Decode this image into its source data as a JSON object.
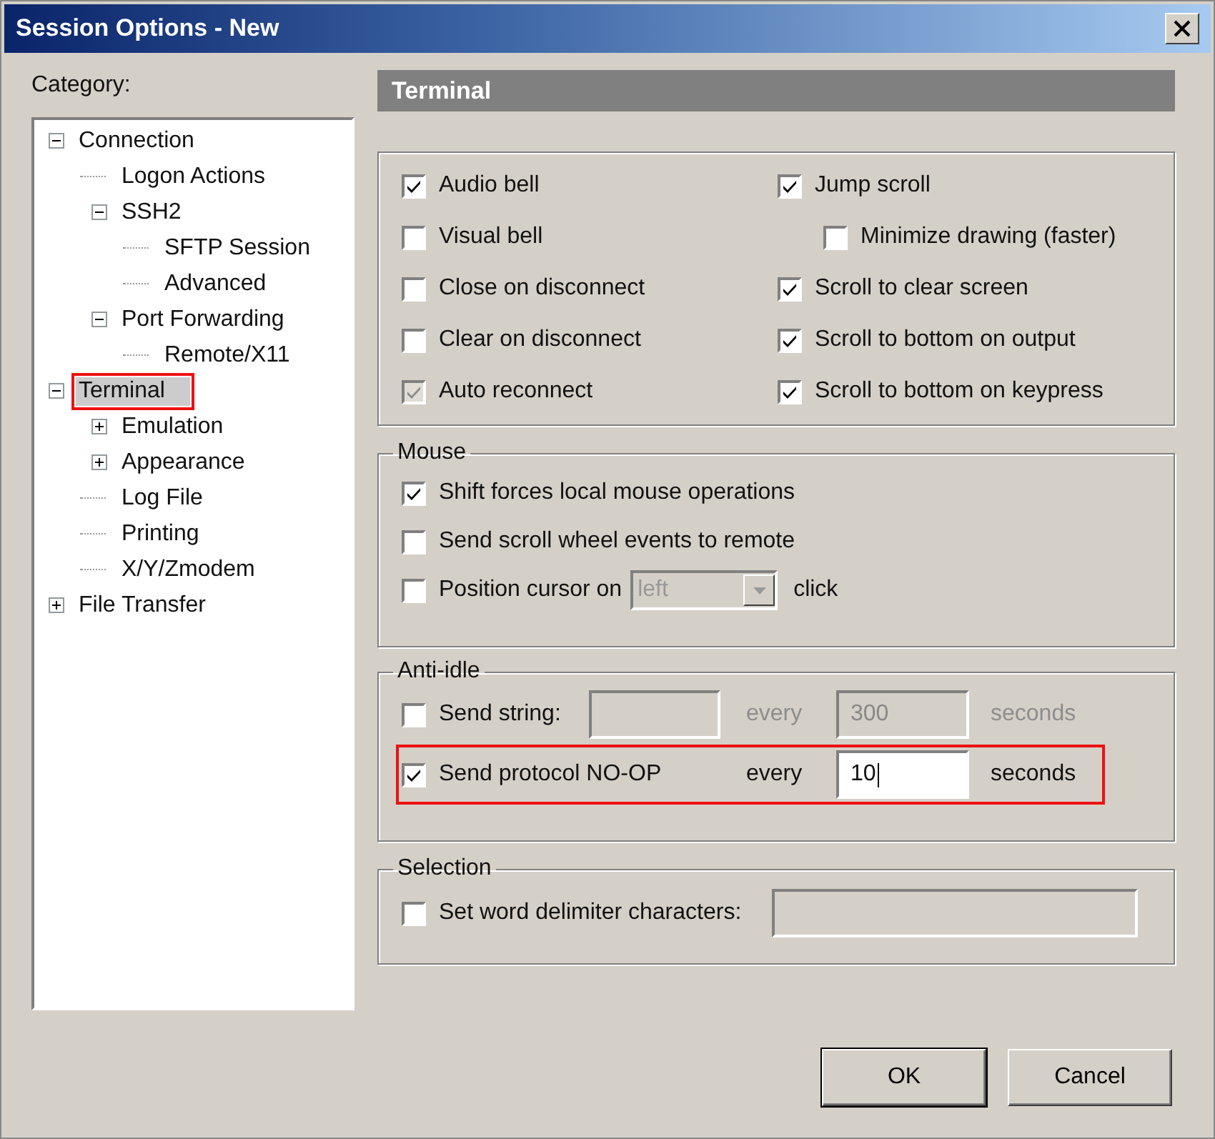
{
  "window": {
    "title": "Session Options - New"
  },
  "category_label": "Category:",
  "tree": [
    {
      "label": "Connection",
      "expanded": true,
      "selected": false,
      "annotated": false,
      "children": [
        {
          "label": "Logon Actions",
          "selected": false,
          "annotated": false
        },
        {
          "label": "SSH2",
          "expanded": true,
          "selected": false,
          "annotated": false,
          "children": [
            {
              "label": "SFTP Session",
              "selected": false,
              "annotated": false
            },
            {
              "label": "Advanced",
              "selected": false,
              "annotated": false
            }
          ]
        },
        {
          "label": "Port Forwarding",
          "expanded": true,
          "selected": false,
          "annotated": false,
          "children": [
            {
              "label": "Remote/X11",
              "selected": false,
              "annotated": false
            }
          ]
        }
      ]
    },
    {
      "label": "Terminal",
      "expanded": true,
      "selected": true,
      "annotated": true,
      "children": [
        {
          "label": "Emulation",
          "expanded": false,
          "selected": false,
          "annotated": false
        },
        {
          "label": "Appearance",
          "expanded": false,
          "selected": false,
          "annotated": false
        },
        {
          "label": "Log File",
          "selected": false,
          "annotated": false
        },
        {
          "label": "Printing",
          "selected": false,
          "annotated": false
        },
        {
          "label": "X/Y/Zmodem",
          "selected": false,
          "annotated": false
        }
      ]
    },
    {
      "label": "File Transfer",
      "expanded": false,
      "selected": false,
      "annotated": false
    }
  ],
  "panel_title": "Terminal",
  "options": [
    {
      "label": "Audio bell",
      "checked": true,
      "disabled": false,
      "kind": "main"
    },
    {
      "label": "Jump scroll",
      "checked": true,
      "disabled": false,
      "kind": "main"
    },
    {
      "label": "Visual bell",
      "checked": false,
      "disabled": false,
      "kind": "main"
    },
    {
      "label": "Minimize drawing (faster)",
      "checked": false,
      "disabled": false,
      "kind": "sub"
    },
    {
      "label": "Close on disconnect",
      "checked": false,
      "disabled": false,
      "kind": "main"
    },
    {
      "label": "Scroll to clear screen",
      "checked": true,
      "disabled": false,
      "kind": "main"
    },
    {
      "label": "Clear on disconnect",
      "checked": false,
      "disabled": false,
      "kind": "main"
    },
    {
      "label": "Scroll to bottom on output",
      "checked": true,
      "disabled": false,
      "kind": "main"
    },
    {
      "label": "Auto reconnect",
      "checked": true,
      "disabled": true,
      "kind": "main"
    },
    {
      "label": "Scroll to bottom on keypress",
      "checked": true,
      "disabled": false,
      "kind": "main"
    }
  ],
  "mouse": {
    "title": "Mouse",
    "options": [
      {
        "label": "Shift forces local mouse operations",
        "checked": true,
        "kind": "plain"
      },
      {
        "label": "Send scroll wheel events to remote",
        "checked": false,
        "kind": "plain"
      },
      {
        "label": "Position cursor on",
        "checked": false,
        "kind": "dropdown",
        "dropdown": {
          "value": "left",
          "disabled": true
        },
        "suffix": "click"
      }
    ]
  },
  "anti_idle": {
    "title": "Anti-idle",
    "rows": [
      {
        "kind": "string",
        "label": "Send string:",
        "checked": false,
        "disabled": true,
        "annotated": false,
        "every": "every",
        "interval": "300",
        "unit": "seconds"
      },
      {
        "kind": "noop",
        "label": "Send protocol NO-OP",
        "checked": true,
        "disabled": false,
        "annotated": true,
        "every": "every",
        "interval": "10",
        "unit": "seconds"
      }
    ]
  },
  "selection": {
    "title": "Selection",
    "option": {
      "label": "Set word delimiter characters:",
      "checked": false
    }
  },
  "buttons": [
    "OK",
    "Cancel"
  ]
}
